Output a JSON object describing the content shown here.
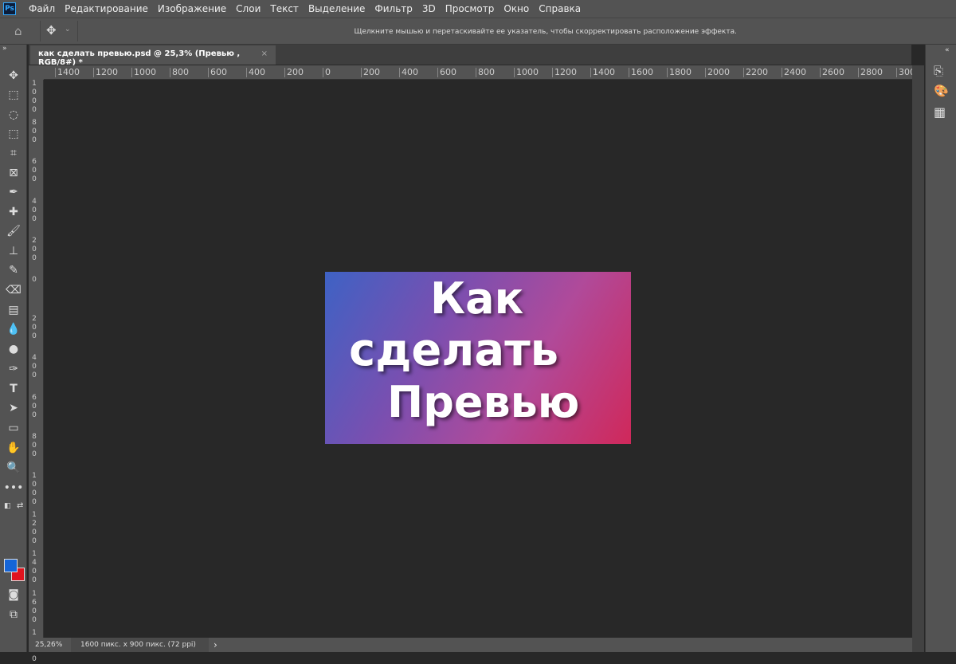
{
  "app": {
    "logo": "Ps"
  },
  "menu": [
    "Файл",
    "Редактирование",
    "Изображение",
    "Слои",
    "Текст",
    "Выделение",
    "Фильтр",
    "3D",
    "Просмотр",
    "Окно",
    "Справка"
  ],
  "options": {
    "hint": "Щелкните мышью и перетаскивайте ее указатель, чтобы скорректировать расположение эффекта."
  },
  "document": {
    "tab_title": "как сделать превью.psd @ 25,3% (Превью , RGB/8#) *",
    "close": "×"
  },
  "ruler": {
    "horizontal": [
      "1400",
      "1200",
      "1000",
      "800",
      "600",
      "400",
      "200",
      "0",
      "200",
      "400",
      "600",
      "800",
      "1000",
      "1200",
      "1400",
      "1600",
      "1800",
      "2000",
      "2200",
      "2400",
      "2600",
      "2800",
      "300"
    ],
    "vertical": [
      "1000",
      "800",
      "600",
      "400",
      "200",
      "0",
      "200",
      "400",
      "600",
      "800",
      "1000",
      "1200",
      "1400",
      "1600",
      "1800"
    ]
  },
  "image": {
    "line1": "Как",
    "line2": "сделать",
    "line3": "Превью"
  },
  "colors": {
    "foreground": "#1565d8",
    "background": "#e0141e"
  },
  "status": {
    "zoom": "25,26%",
    "size": "1600 пикс. x 900 пикс. (72 ppi)",
    "arrow": "›"
  }
}
